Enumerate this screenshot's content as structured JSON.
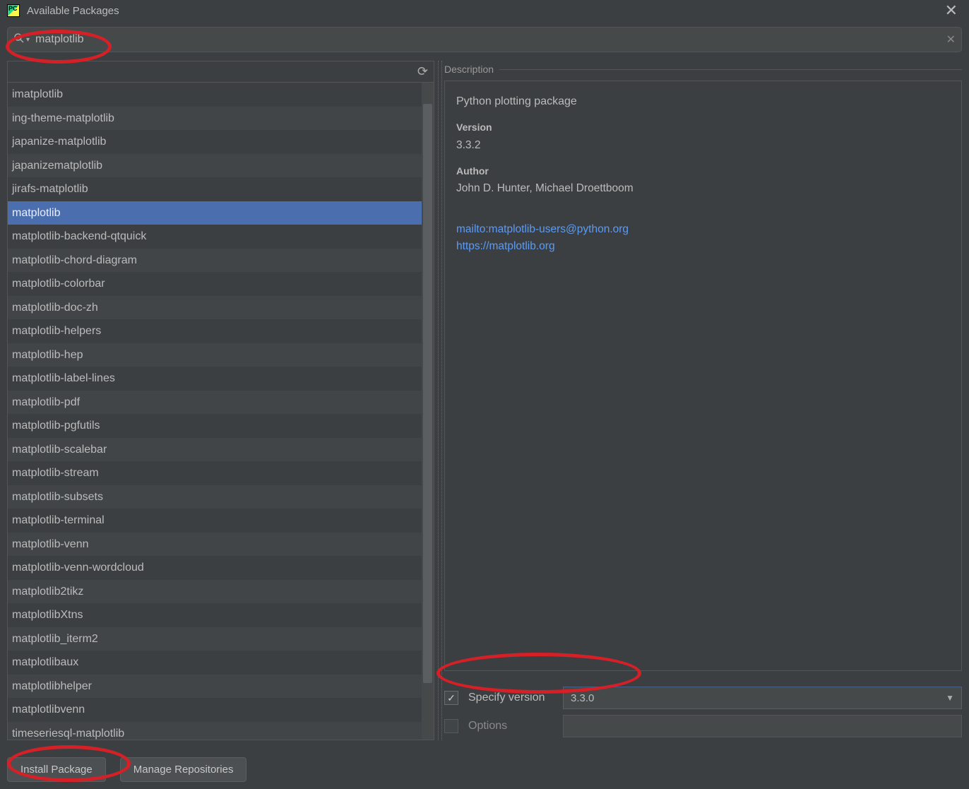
{
  "window": {
    "title": "Available Packages"
  },
  "search": {
    "value": "matplotlib"
  },
  "packages": [
    "imatplotlib",
    "ing-theme-matplotlib",
    "japanize-matplotlib",
    "japanizematplotlib",
    "jirafs-matplotlib",
    "matplotlib",
    "matplotlib-backend-qtquick",
    "matplotlib-chord-diagram",
    "matplotlib-colorbar",
    "matplotlib-doc-zh",
    "matplotlib-helpers",
    "matplotlib-hep",
    "matplotlib-label-lines",
    "matplotlib-pdf",
    "matplotlib-pgfutils",
    "matplotlib-scalebar",
    "matplotlib-stream",
    "matplotlib-subsets",
    "matplotlib-terminal",
    "matplotlib-venn",
    "matplotlib-venn-wordcloud",
    "matplotlib2tikz",
    "matplotlibXtns",
    "matplotlib_iterm2",
    "matplotlibaux",
    "matplotlibhelper",
    "matplotlibvenn",
    "timeseriesql-matplotlib"
  ],
  "selected_index": 5,
  "description": {
    "label": "Description",
    "summary": "Python plotting package",
    "version_label": "Version",
    "version": "3.3.2",
    "author_label": "Author",
    "author": "John D. Hunter, Michael Droettboom",
    "mailto": "mailto:matplotlib-users@python.org",
    "homepage": "https://matplotlib.org"
  },
  "controls": {
    "specify_version_label": "Specify version",
    "specify_version_checked": true,
    "selected_version": "3.3.0",
    "options_label": "Options",
    "options_checked": false
  },
  "footer": {
    "install": "Install Package",
    "manage": "Manage Repositories"
  }
}
